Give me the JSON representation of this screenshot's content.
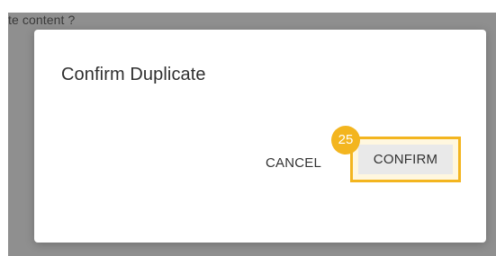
{
  "background": {
    "partial_text": "te content ?"
  },
  "dialog": {
    "title": "Confirm Duplicate",
    "actions": {
      "cancel_label": "CANCEL",
      "confirm_label": "CONFIRM"
    }
  },
  "annotation": {
    "step_number": "25",
    "highlight_color": "#f3b51f"
  }
}
